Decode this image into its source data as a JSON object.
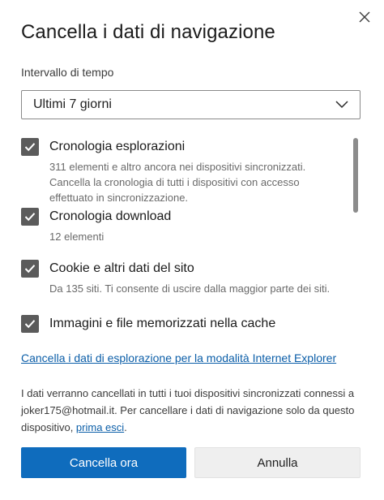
{
  "dialog": {
    "title": "Cancella i dati di navigazione",
    "close_icon": "close-icon"
  },
  "time_range": {
    "label": "Intervallo di tempo",
    "selected": "Ultimi 7 giorni"
  },
  "options": [
    {
      "title": "Cronologia esplorazioni",
      "description": "311 elementi e altro ancora nei dispositivi sincronizzati. Cancella la cronologia di tutti i dispositivi con accesso effettuato in sincronizzazione.",
      "checked": true
    },
    {
      "title": "Cronologia download",
      "description": "12 elementi",
      "checked": true
    },
    {
      "title": "Cookie e altri dati del sito",
      "description": "Da 135 siti. Ti consente di uscire dalla maggior parte dei siti.",
      "checked": true
    },
    {
      "title": "Immagini e file memorizzati nella cache",
      "description": "",
      "checked": true
    }
  ],
  "ie_link": "Cancella i dati di esplorazione per la modalità Internet Explorer",
  "info": {
    "text": "I dati verranno cancellati in tutti i tuoi dispositivi sincronizzati connessi a joker175@hotmail.it. Per cancellare i dati di navigazione solo da questo dispositivo, ",
    "link": "prima esci",
    "suffix": "."
  },
  "buttons": {
    "primary": "Cancella ora",
    "secondary": "Annulla"
  },
  "colors": {
    "accent": "#0f6cbd",
    "link": "#0b5ea8",
    "checkbox": "#5b5b5b"
  }
}
